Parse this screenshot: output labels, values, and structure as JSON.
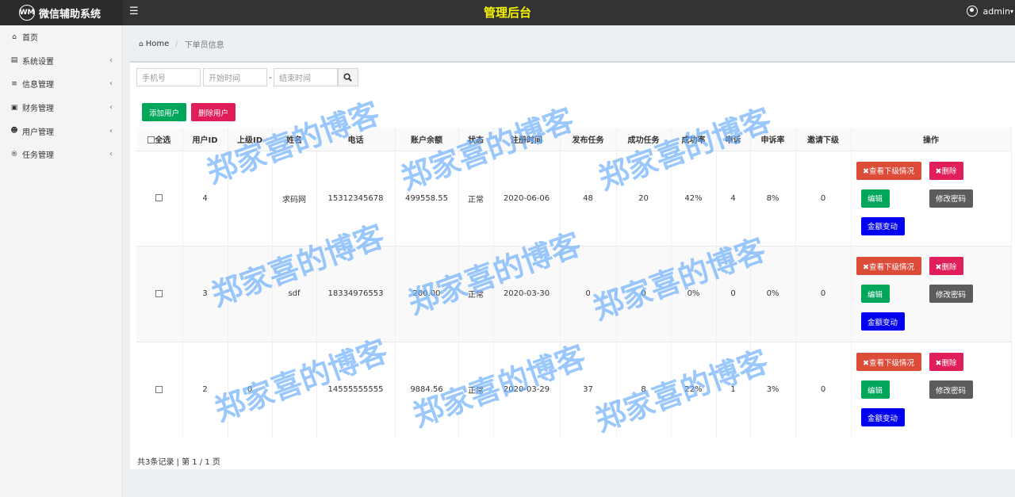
{
  "brand": {
    "logo_text": "WM",
    "name": "微信辅助系统"
  },
  "header": {
    "menu_icon": "hamburger-icon",
    "title": "管理后台",
    "user": "admin"
  },
  "sidebar": {
    "items": [
      {
        "label": "首页",
        "icon": "home-icon",
        "chevron": ""
      },
      {
        "label": "系统设置",
        "icon": "settings-icon",
        "chevron": "‹"
      },
      {
        "label": "信息管理",
        "icon": "list-icon",
        "chevron": "‹"
      },
      {
        "label": "财务管理",
        "icon": "money-icon",
        "chevron": "‹"
      },
      {
        "label": "用户管理",
        "icon": "users-icon",
        "chevron": "‹"
      },
      {
        "label": "任务管理",
        "icon": "registered-icon",
        "chevron": "‹"
      }
    ]
  },
  "breadcrumb": {
    "home": "Home",
    "current": "下单员信息"
  },
  "search": {
    "phone_placeholder": "手机号",
    "start_placeholder": "开始时间",
    "dash": "-",
    "end_placeholder": "结束时间"
  },
  "actions": {
    "add": "添加用户",
    "delete": "删除用户"
  },
  "table": {
    "headers": [
      "全选",
      "用户ID",
      "上级ID",
      "姓名",
      "电话",
      "账户余额",
      "状态",
      "注册时间",
      "发布任务",
      "成功任务",
      "成功率",
      "申诉",
      "申诉率",
      "邀请下级",
      "操作"
    ],
    "rows": [
      {
        "id": "4",
        "parent": "",
        "name": "求码网",
        "phone": "15312345678",
        "balance": "499558.55",
        "status": "正常",
        "reg": "2020-06-06",
        "published": "48",
        "success": "20",
        "rate": "42%",
        "appeal": "4",
        "appeal_rate": "8%",
        "invites": "0"
      },
      {
        "id": "3",
        "parent": "",
        "name": "sdf",
        "phone": "18334976553",
        "balance": "200.00",
        "status": "正常",
        "reg": "2020-03-30",
        "published": "0",
        "success": "0",
        "rate": "0%",
        "appeal": "0",
        "appeal_rate": "0%",
        "invites": "0"
      },
      {
        "id": "2",
        "parent": "0",
        "name": "",
        "phone": "14555555555",
        "balance": "9884.56",
        "status": "正常",
        "reg": "2020-03-29",
        "published": "37",
        "success": "8",
        "rate": "22%",
        "appeal": "1",
        "appeal_rate": "3%",
        "invites": "0"
      }
    ],
    "op_buttons": {
      "view": "✖查看下级情况",
      "del": "✖删除",
      "edit": "编辑",
      "pwd": "修改密码",
      "money": "金额变动"
    }
  },
  "pager": "共3条记录 | 第 1 / 1 页",
  "watermark": "郑家喜的博客",
  "colors": {
    "topbar": "#333333",
    "title": "#f6f600",
    "green": "#00a65a",
    "pink": "#e01e5a",
    "orange": "#dd4b39",
    "gray": "#5c5c5c",
    "blue": "#0000ee"
  }
}
